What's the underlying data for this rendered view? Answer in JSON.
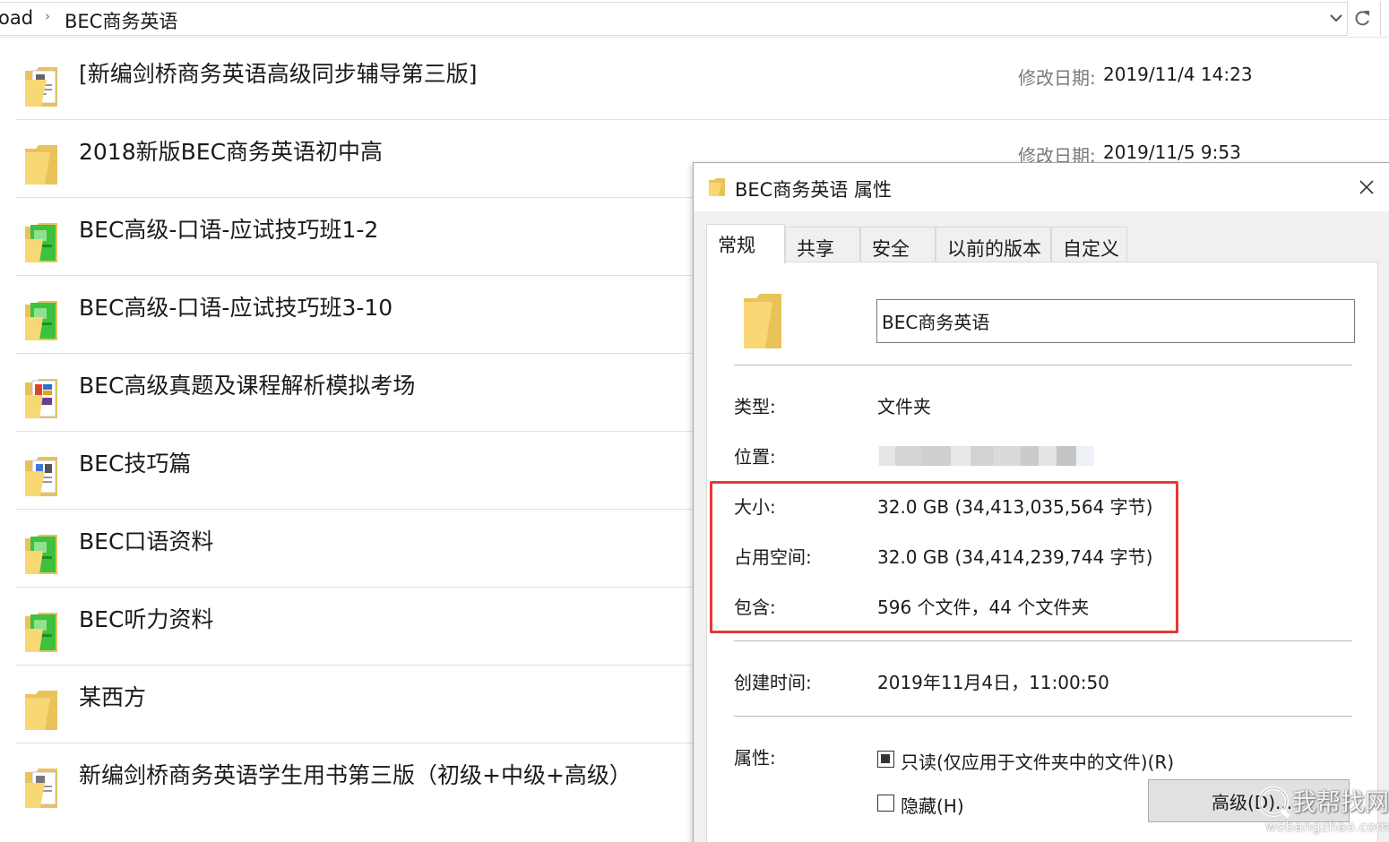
{
  "address_bar": {
    "crumbs": [
      "oad",
      "BEC商务英语"
    ],
    "separator": "›"
  },
  "file_list": {
    "modified_label": "修改日期:",
    "rows": [
      {
        "name": "[新编剑桥商务英语高级同步辅导第三版]",
        "icon": "folder-documents-icon",
        "modified": "2019/11/4 14:23"
      },
      {
        "name": "2018新版BEC商务英语初中高",
        "icon": "folder-icon",
        "modified": "2019/11/5 9:53"
      },
      {
        "name": "BEC高级-口语-应试技巧班1-2",
        "icon": "folder-green-books-icon",
        "modified": ""
      },
      {
        "name": "BEC高级-口语-应试技巧班3-10",
        "icon": "folder-green-books-icon",
        "modified": ""
      },
      {
        "name": "BEC高级真题及课程解析模拟考场",
        "icon": "folder-colorful-docs-icon",
        "modified": ""
      },
      {
        "name": "BEC技巧篇",
        "icon": "folder-documents-icon",
        "modified": ""
      },
      {
        "name": "BEC口语资料",
        "icon": "folder-green-books-icon",
        "modified": ""
      },
      {
        "name": "BEC听力资料",
        "icon": "folder-green-books-icon",
        "modified": ""
      },
      {
        "name": "某西方",
        "icon": "folder-icon",
        "modified": ""
      },
      {
        "name": "新编剑桥商务英语学生用书第三版（初级+中级+高级）",
        "icon": "folder-documents-icon",
        "modified": ""
      }
    ]
  },
  "dialog": {
    "title": "BEC商务英语 属性",
    "tabs": [
      {
        "label": "常规",
        "active": true
      },
      {
        "label": "共享",
        "active": false
      },
      {
        "label": "安全",
        "active": false
      },
      {
        "label": "以前的版本",
        "active": false
      },
      {
        "label": "自定义",
        "active": false
      }
    ],
    "name_value": "BEC商务英语",
    "type_label": "类型:",
    "type_value": "文件夹",
    "location_label": "位置:",
    "size_label": "大小:",
    "size_value": "32.0 GB (34,413,035,564 字节)",
    "disk_label": "占用空间:",
    "disk_value": "32.0 GB (34,414,239,744 字节)",
    "contains_label": "包含:",
    "contains_value": "596 个文件，44 个文件夹",
    "created_label": "创建时间:",
    "created_value": "2019年11月4日，11:00:50",
    "attributes_label": "属性:",
    "readonly_label": "只读(仅应用于文件夹中的文件)(R)",
    "readonly_state": "indeterminate",
    "hidden_label": "隐藏(H)",
    "hidden_state": "unchecked",
    "advanced_label": "高级(D)..."
  },
  "watermark": {
    "text": "我帮找网",
    "url": "wobangzhao.com"
  },
  "colors": {
    "highlight_border": "#e53935",
    "folder_yellow": "#f8d775",
    "folder_green": "#3cc23c"
  }
}
